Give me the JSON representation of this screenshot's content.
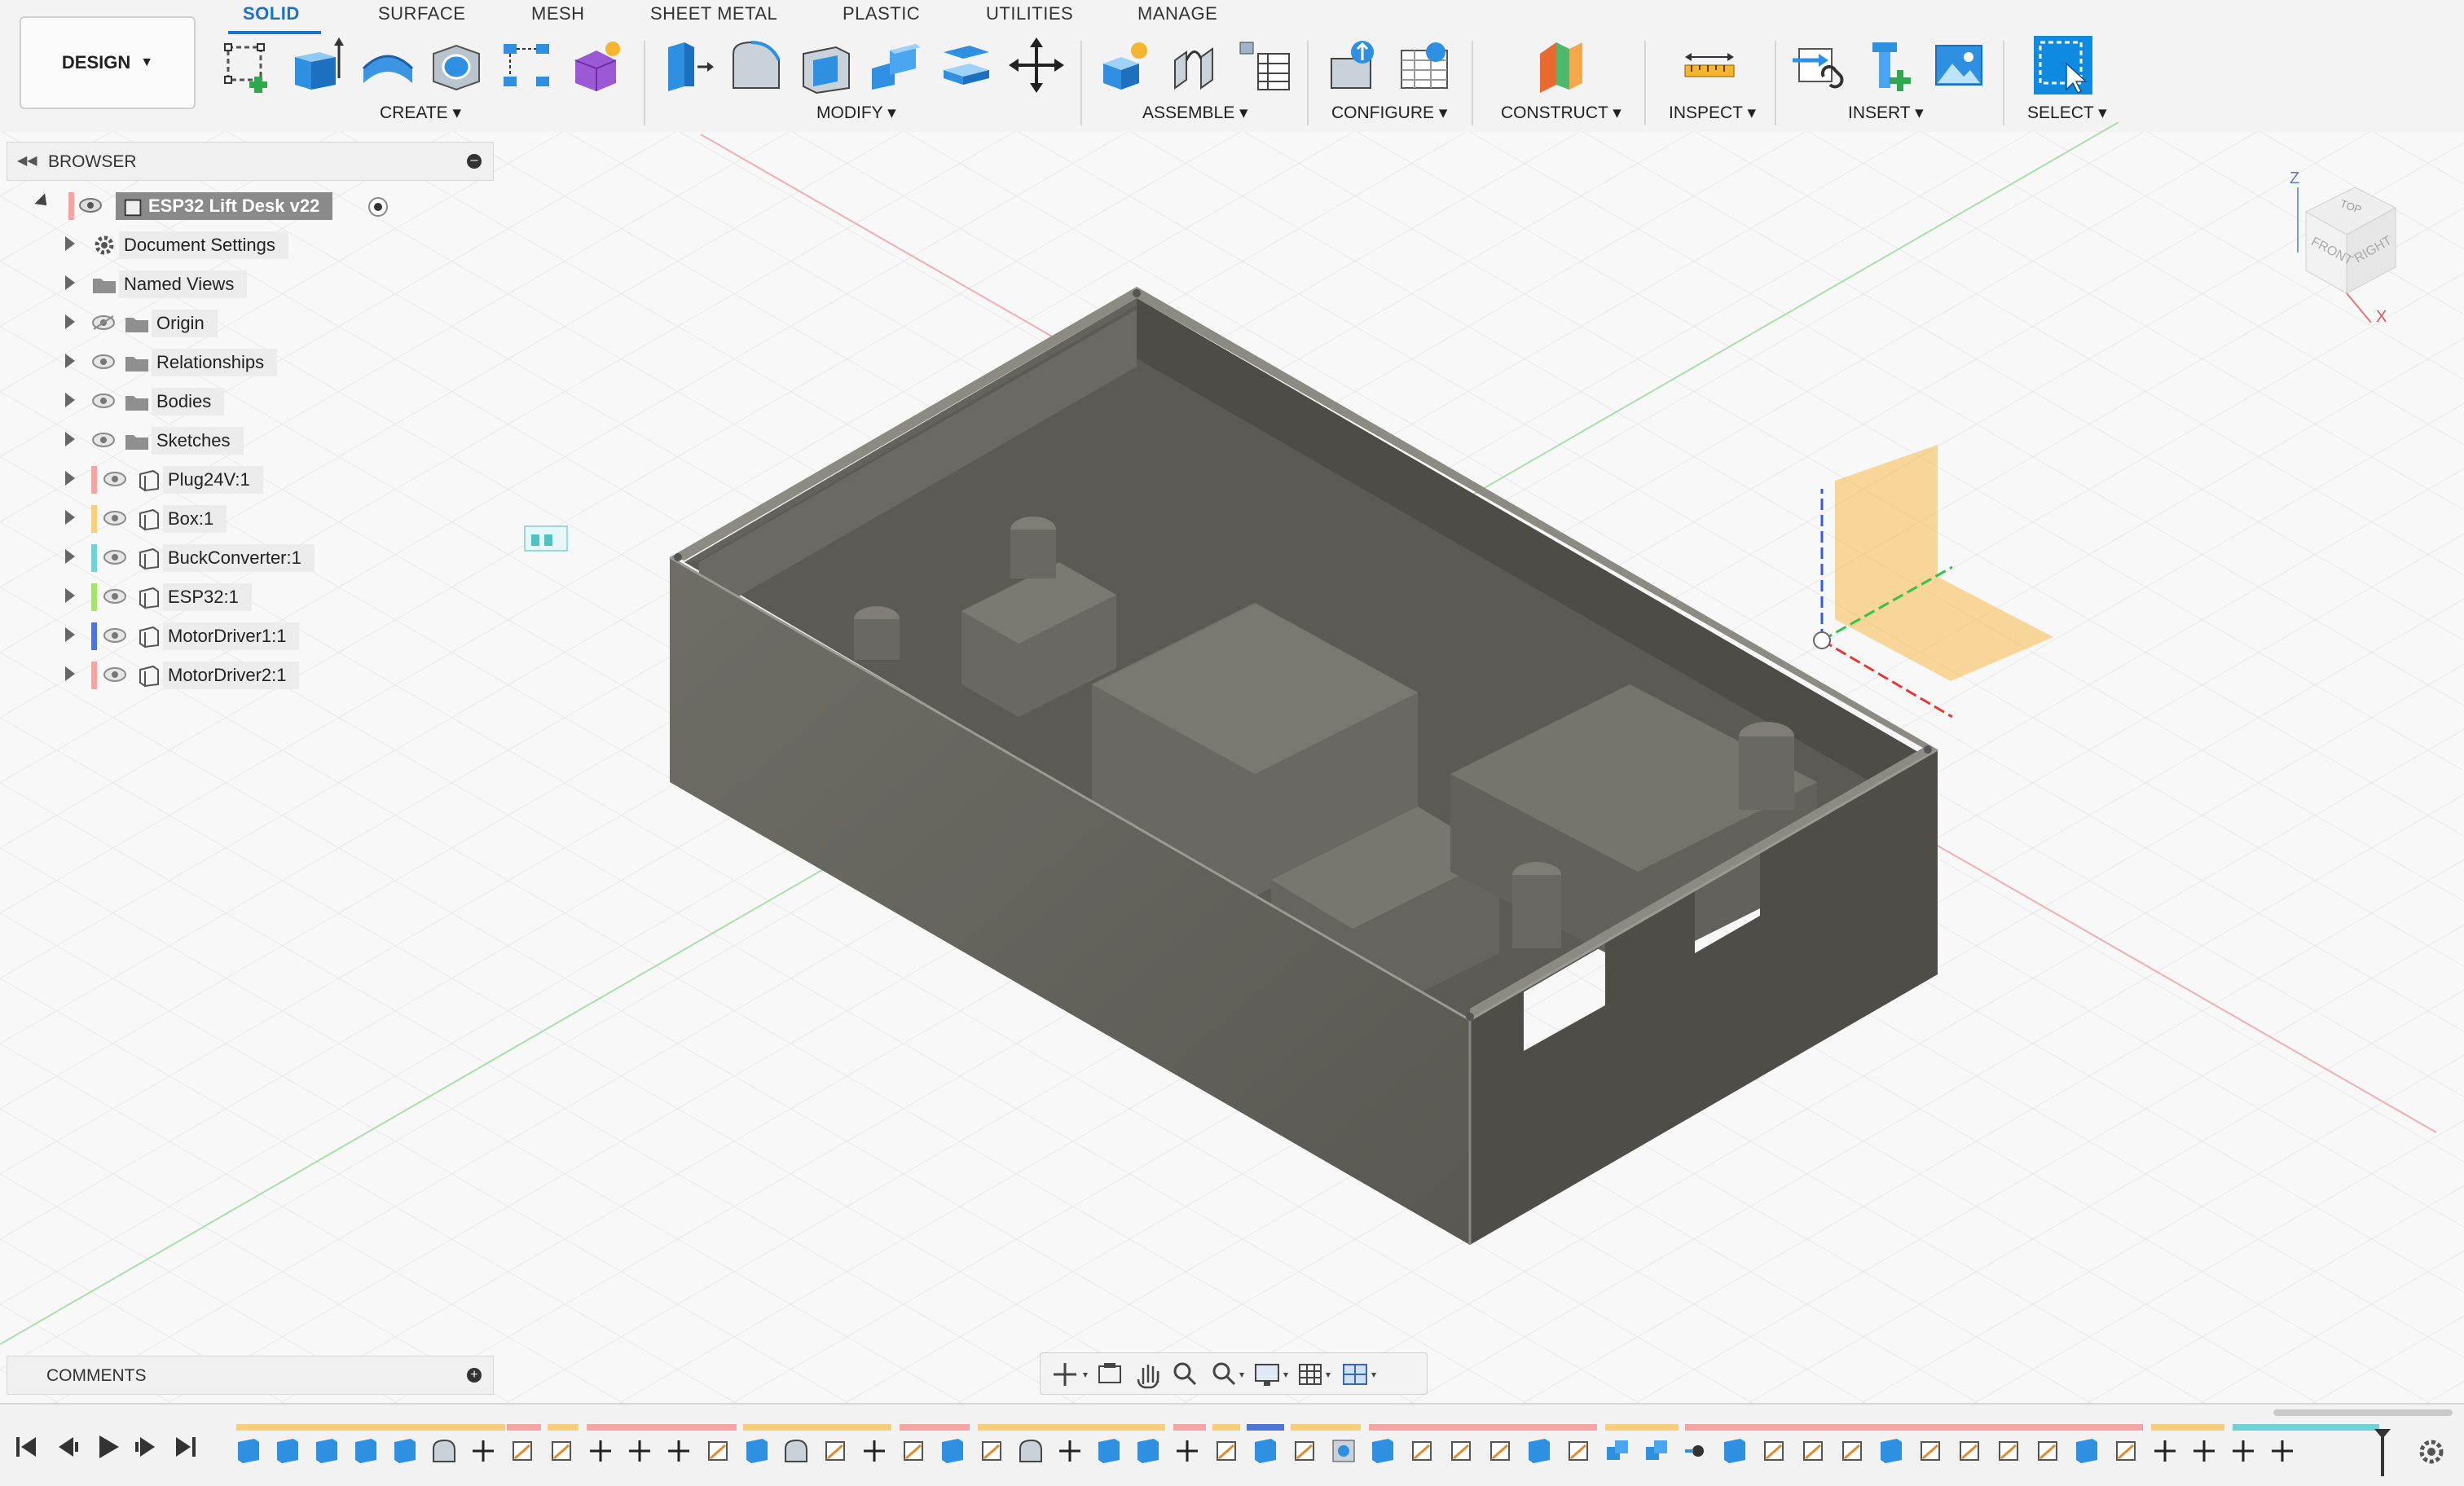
{
  "toolbar": {
    "workspace_label": "DESIGN",
    "tabs": [
      {
        "label": "SOLID",
        "active": true
      },
      {
        "label": "SURFACE"
      },
      {
        "label": "MESH"
      },
      {
        "label": "SHEET METAL"
      },
      {
        "label": "PLASTIC"
      },
      {
        "label": "UTILITIES"
      },
      {
        "label": "MANAGE"
      }
    ],
    "groups": [
      {
        "label": "CREATE ▾"
      },
      {
        "label": "MODIFY ▾"
      },
      {
        "label": "ASSEMBLE ▾"
      },
      {
        "label": "CONFIGURE ▾"
      },
      {
        "label": "CONSTRUCT ▾"
      },
      {
        "label": "INSPECT ▾"
      },
      {
        "label": "INSERT ▾"
      },
      {
        "label": "SELECT ▾"
      }
    ]
  },
  "browser": {
    "title": "BROWSER",
    "root": {
      "label": "ESP32 Lift Desk v22"
    },
    "items": [
      {
        "label": "Document Settings",
        "icon": "gear-icon"
      },
      {
        "label": "Named Views",
        "icon": "folder-icon"
      },
      {
        "label": "Origin",
        "icon": "folder-icon",
        "hidden": true
      },
      {
        "label": "Relationships",
        "icon": "folder-icon"
      },
      {
        "label": "Bodies",
        "icon": "folder-icon"
      },
      {
        "label": "Sketches",
        "icon": "folder-icon"
      },
      {
        "label": "Plug24V:1",
        "icon": "component-icon",
        "color": "#f4a4a4"
      },
      {
        "label": "Box:1",
        "icon": "component-icon",
        "color": "#f7cf7c"
      },
      {
        "label": "BuckConverter:1",
        "icon": "component-icon",
        "color": "#6fd3d6"
      },
      {
        "label": "ESP32:1",
        "icon": "component-icon",
        "color": "#a6e36a"
      },
      {
        "label": "MotorDriver1:1",
        "icon": "component-icon",
        "color": "#4f73d8"
      },
      {
        "label": "MotorDriver2:1",
        "icon": "component-icon",
        "color": "#f4a4a4"
      }
    ]
  },
  "viewcube": {
    "top": "TOP",
    "front": "FRONT",
    "right": "RIGHT",
    "axis_z": "Z",
    "axis_x": "X"
  },
  "comments": {
    "title": "COMMENTS"
  }
}
